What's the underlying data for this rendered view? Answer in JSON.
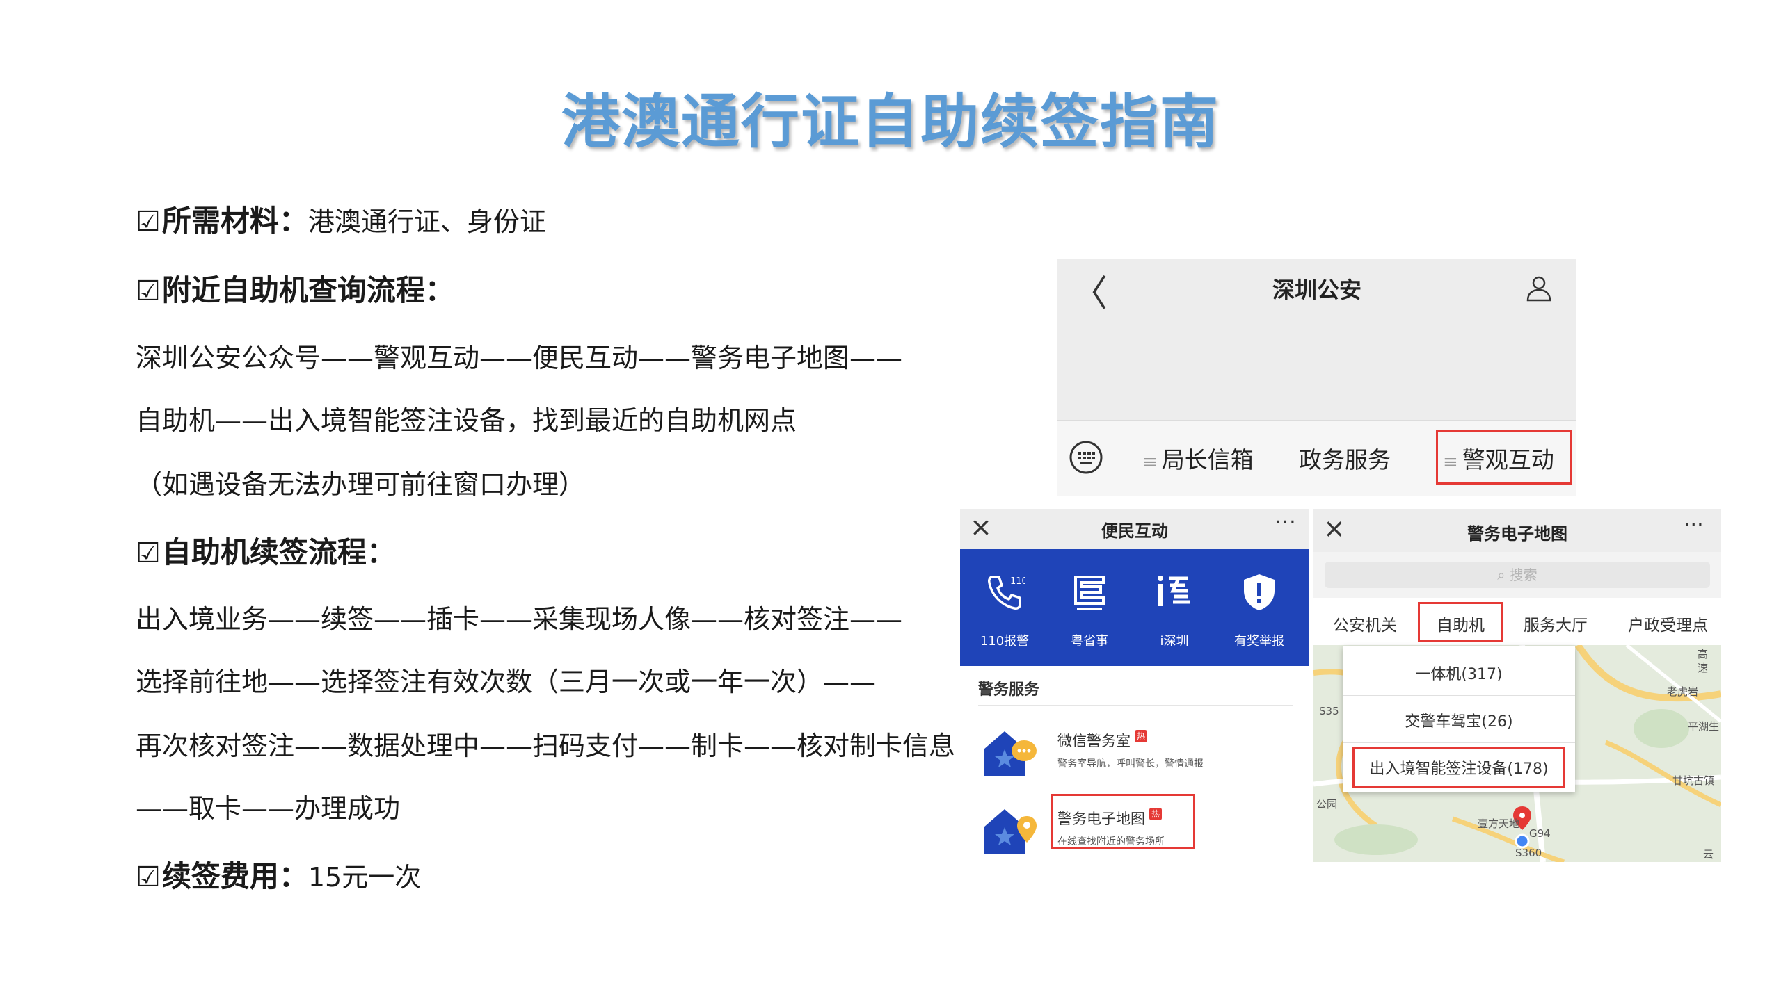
{
  "title": "港澳通行证自助续签指南",
  "text": {
    "materials_label": "所需材料：",
    "materials_value": "港澳通行证、身份证",
    "query_label": "附近自助机查询流程：",
    "query_line1": "深圳公安公众号——警观互动——便民互动——警务电子地图——",
    "query_line2": "自助机——出入境智能签注设备，找到最近的自助机网点",
    "query_line3": "（如遇设备无法办理可前往窗口办理）",
    "renew_label": "自助机续签流程：",
    "renew_line1": "出入境业务——续签——插卡——采集现场人像——核对签注——",
    "renew_line2": "选择前往地——选择签注有效次数（三月一次或一年一次）——",
    "renew_line3": "再次核对签注——数据处理中——扫码支付——制卡——核对制卡信息",
    "renew_line4": "——取卡——办理成功",
    "fee_label": "续签费用：",
    "fee_value": "15元一次",
    "checkbox_glyph": "☑"
  },
  "panel_a": {
    "title": "深圳公安",
    "back_glyph": "〈",
    "menu": [
      "局长信箱",
      "政务服务",
      "警观互动"
    ],
    "menu_prefix": "≡"
  },
  "panel_b": {
    "title": "便民互动",
    "close_glyph": "×",
    "more_glyph": "···",
    "quick_actions": [
      "110报警",
      "粤省事",
      "i深圳",
      "有奖举报"
    ],
    "badge_110": "110",
    "section_title": "警务服务",
    "items": [
      {
        "name": "微信警务室",
        "hot": "热",
        "desc": "警务室导航，呼叫警长，警情通报"
      },
      {
        "name": "警务电子地图",
        "hot": "热",
        "desc": "在线查找附近的警务场所"
      }
    ]
  },
  "panel_c": {
    "title": "警务电子地图",
    "close_glyph": "×",
    "more_glyph": "···",
    "search_placeholder": "搜索",
    "tabs": [
      "公安机关",
      "自助机",
      "服务大厅",
      "户政受理点"
    ],
    "dropdown": [
      "一体机(317)",
      "交警车驾宝(26)",
      "出入境智能签注设备(178)"
    ],
    "map_labels": [
      "高",
      "速",
      "老虎岩",
      "平湖生",
      "甘坑古镇",
      "壹方天地",
      "S35",
      "G94",
      "S360",
      "公园",
      "云"
    ]
  },
  "colors": {
    "title": "#5b9bd5",
    "highlight": "#e53935",
    "brand_blue": "#1f44b8"
  }
}
